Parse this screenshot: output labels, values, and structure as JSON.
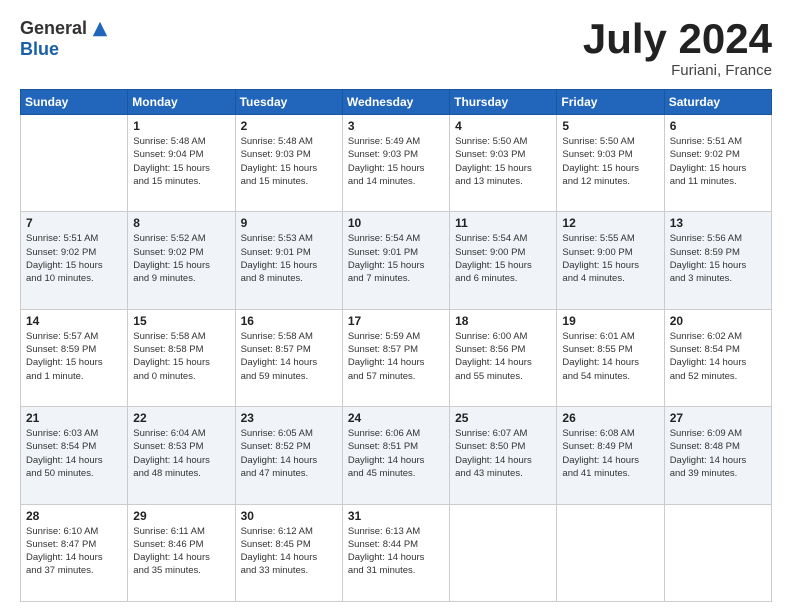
{
  "header": {
    "logo_general": "General",
    "logo_blue": "Blue",
    "month": "July 2024",
    "location": "Furiani, France"
  },
  "weekdays": [
    "Sunday",
    "Monday",
    "Tuesday",
    "Wednesday",
    "Thursday",
    "Friday",
    "Saturday"
  ],
  "weeks": [
    [
      {
        "day": "",
        "info": ""
      },
      {
        "day": "1",
        "info": "Sunrise: 5:48 AM\nSunset: 9:04 PM\nDaylight: 15 hours\nand 15 minutes."
      },
      {
        "day": "2",
        "info": "Sunrise: 5:48 AM\nSunset: 9:03 PM\nDaylight: 15 hours\nand 15 minutes."
      },
      {
        "day": "3",
        "info": "Sunrise: 5:49 AM\nSunset: 9:03 PM\nDaylight: 15 hours\nand 14 minutes."
      },
      {
        "day": "4",
        "info": "Sunrise: 5:50 AM\nSunset: 9:03 PM\nDaylight: 15 hours\nand 13 minutes."
      },
      {
        "day": "5",
        "info": "Sunrise: 5:50 AM\nSunset: 9:03 PM\nDaylight: 15 hours\nand 12 minutes."
      },
      {
        "day": "6",
        "info": "Sunrise: 5:51 AM\nSunset: 9:02 PM\nDaylight: 15 hours\nand 11 minutes."
      }
    ],
    [
      {
        "day": "7",
        "info": "Sunrise: 5:51 AM\nSunset: 9:02 PM\nDaylight: 15 hours\nand 10 minutes."
      },
      {
        "day": "8",
        "info": "Sunrise: 5:52 AM\nSunset: 9:02 PM\nDaylight: 15 hours\nand 9 minutes."
      },
      {
        "day": "9",
        "info": "Sunrise: 5:53 AM\nSunset: 9:01 PM\nDaylight: 15 hours\nand 8 minutes."
      },
      {
        "day": "10",
        "info": "Sunrise: 5:54 AM\nSunset: 9:01 PM\nDaylight: 15 hours\nand 7 minutes."
      },
      {
        "day": "11",
        "info": "Sunrise: 5:54 AM\nSunset: 9:00 PM\nDaylight: 15 hours\nand 6 minutes."
      },
      {
        "day": "12",
        "info": "Sunrise: 5:55 AM\nSunset: 9:00 PM\nDaylight: 15 hours\nand 4 minutes."
      },
      {
        "day": "13",
        "info": "Sunrise: 5:56 AM\nSunset: 8:59 PM\nDaylight: 15 hours\nand 3 minutes."
      }
    ],
    [
      {
        "day": "14",
        "info": "Sunrise: 5:57 AM\nSunset: 8:59 PM\nDaylight: 15 hours\nand 1 minute."
      },
      {
        "day": "15",
        "info": "Sunrise: 5:58 AM\nSunset: 8:58 PM\nDaylight: 15 hours\nand 0 minutes."
      },
      {
        "day": "16",
        "info": "Sunrise: 5:58 AM\nSunset: 8:57 PM\nDaylight: 14 hours\nand 59 minutes."
      },
      {
        "day": "17",
        "info": "Sunrise: 5:59 AM\nSunset: 8:57 PM\nDaylight: 14 hours\nand 57 minutes."
      },
      {
        "day": "18",
        "info": "Sunrise: 6:00 AM\nSunset: 8:56 PM\nDaylight: 14 hours\nand 55 minutes."
      },
      {
        "day": "19",
        "info": "Sunrise: 6:01 AM\nSunset: 8:55 PM\nDaylight: 14 hours\nand 54 minutes."
      },
      {
        "day": "20",
        "info": "Sunrise: 6:02 AM\nSunset: 8:54 PM\nDaylight: 14 hours\nand 52 minutes."
      }
    ],
    [
      {
        "day": "21",
        "info": "Sunrise: 6:03 AM\nSunset: 8:54 PM\nDaylight: 14 hours\nand 50 minutes."
      },
      {
        "day": "22",
        "info": "Sunrise: 6:04 AM\nSunset: 8:53 PM\nDaylight: 14 hours\nand 48 minutes."
      },
      {
        "day": "23",
        "info": "Sunrise: 6:05 AM\nSunset: 8:52 PM\nDaylight: 14 hours\nand 47 minutes."
      },
      {
        "day": "24",
        "info": "Sunrise: 6:06 AM\nSunset: 8:51 PM\nDaylight: 14 hours\nand 45 minutes."
      },
      {
        "day": "25",
        "info": "Sunrise: 6:07 AM\nSunset: 8:50 PM\nDaylight: 14 hours\nand 43 minutes."
      },
      {
        "day": "26",
        "info": "Sunrise: 6:08 AM\nSunset: 8:49 PM\nDaylight: 14 hours\nand 41 minutes."
      },
      {
        "day": "27",
        "info": "Sunrise: 6:09 AM\nSunset: 8:48 PM\nDaylight: 14 hours\nand 39 minutes."
      }
    ],
    [
      {
        "day": "28",
        "info": "Sunrise: 6:10 AM\nSunset: 8:47 PM\nDaylight: 14 hours\nand 37 minutes."
      },
      {
        "day": "29",
        "info": "Sunrise: 6:11 AM\nSunset: 8:46 PM\nDaylight: 14 hours\nand 35 minutes."
      },
      {
        "day": "30",
        "info": "Sunrise: 6:12 AM\nSunset: 8:45 PM\nDaylight: 14 hours\nand 33 minutes."
      },
      {
        "day": "31",
        "info": "Sunrise: 6:13 AM\nSunset: 8:44 PM\nDaylight: 14 hours\nand 31 minutes."
      },
      {
        "day": "",
        "info": ""
      },
      {
        "day": "",
        "info": ""
      },
      {
        "day": "",
        "info": ""
      }
    ]
  ]
}
